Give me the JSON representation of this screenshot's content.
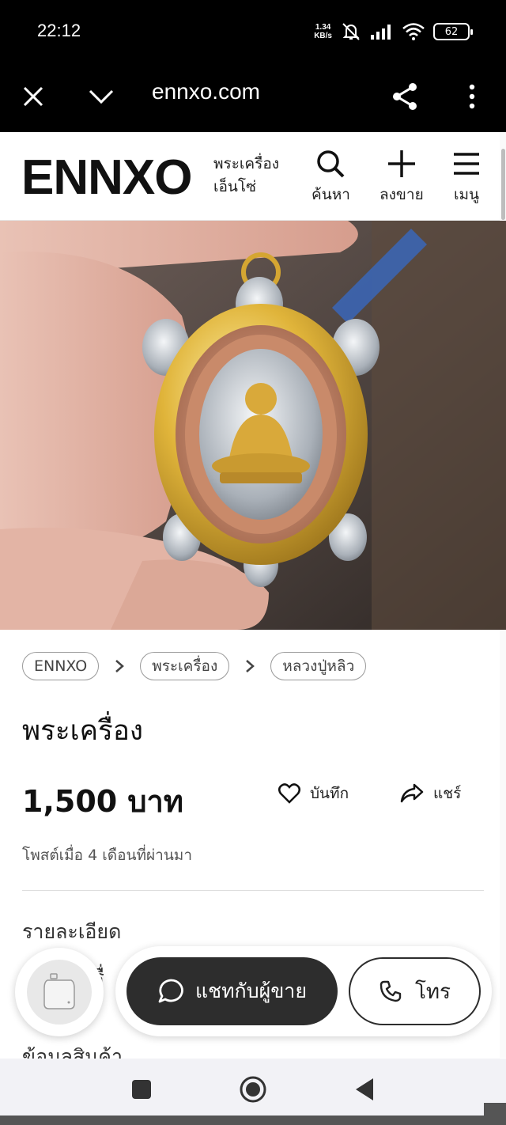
{
  "status_bar": {
    "time": "22:12",
    "net_speed_value": "1.34",
    "net_speed_unit": "KB/s",
    "battery": "62"
  },
  "browser": {
    "url": "ennxo.com"
  },
  "site_header": {
    "logo": "ENNXO",
    "tagline_line1": "พระเครื่อง",
    "tagline_line2": "เอ็นโซ่",
    "search_label": "ค้นหา",
    "sell_label": "ลงขาย",
    "menu_label": "เมนู"
  },
  "breadcrumb": [
    "ENNXO",
    "พระเครื่อง",
    "หลวงปู่หลิว"
  ],
  "product": {
    "title": "พระเครื่อง",
    "price": "1,500 บาท",
    "save_label": "บันทึก",
    "share_label": "แชร์",
    "posted": "โพสต์เมื่อ 4 เดือนที่ผ่านมา"
  },
  "sections": {
    "details_title": "รายละเอียด",
    "details_partial": "เรื่",
    "product_info_title": "ข้อมูลสินค้า"
  },
  "contact": {
    "chat_label": "แชทกับผู้ขาย",
    "call_label": "โทร"
  },
  "colors": {
    "dark_button": "#2d2d2d",
    "status_bar": "#000000"
  }
}
